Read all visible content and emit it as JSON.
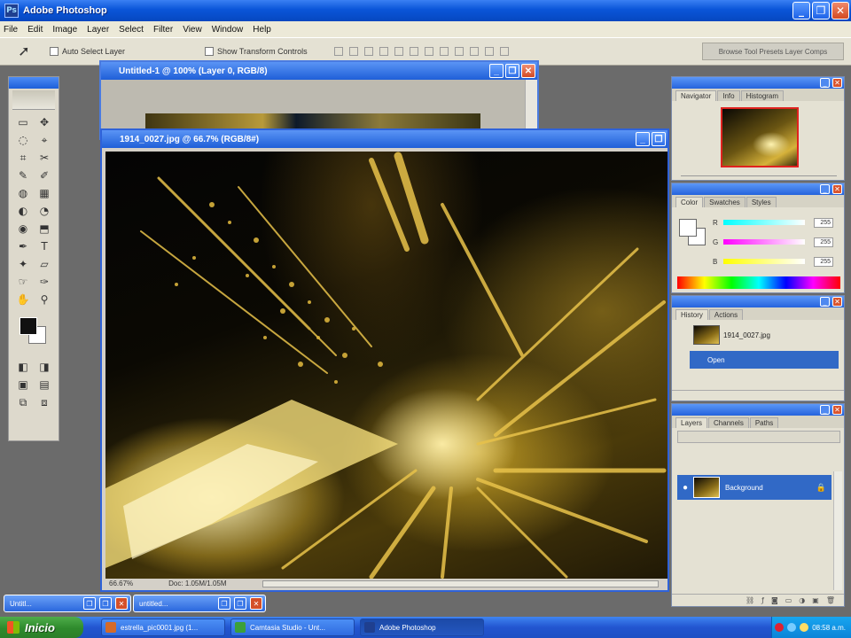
{
  "app": {
    "title": "Adobe Photoshop",
    "icon": "photoshop-icon",
    "window_buttons": {
      "minimize": "_",
      "restore": "❐",
      "close": "✕"
    }
  },
  "menu": [
    "File",
    "Edit",
    "Image",
    "Layer",
    "Select",
    "Filter",
    "View",
    "Window",
    "Help"
  ],
  "options": {
    "tool_icon": "move-tool-icon",
    "auto_select": "Auto Select Layer",
    "show_transform": "Show Transform Controls",
    "palette_well": "Browse  Tool Presets  Layer Comps"
  },
  "toolbox": {
    "tools": [
      "▭",
      "✥",
      "◌",
      "⌖",
      "⌗",
      "✂",
      "✎",
      "✐",
      "◍",
      "▦",
      "◐",
      "◔",
      "◉",
      "⬒",
      "✒",
      "T",
      "✦",
      "▱",
      "☞",
      "✑",
      "✋",
      "⚲"
    ],
    "bottom": [
      "◧",
      "◨",
      "▣",
      "▤",
      "⧉",
      "⧈"
    ]
  },
  "doc_back": {
    "title": "Untitled-1 @ 100% (Layer 0, RGB/8)"
  },
  "doc_front": {
    "title": "1914_0027.jpg @ 66.7% (RGB/8#)",
    "zoom": "66.67%",
    "doc_size": "Doc: 1.05M/1.05M"
  },
  "navigator": {
    "tabs": [
      "Navigator",
      "Info",
      "Histogram"
    ]
  },
  "color": {
    "tabs": [
      "Color",
      "Swatches",
      "Styles"
    ],
    "channels": [
      {
        "label": "R",
        "value": "255"
      },
      {
        "label": "G",
        "value": "255"
      },
      {
        "label": "B",
        "value": "255"
      }
    ]
  },
  "history": {
    "tabs": [
      "History",
      "Actions"
    ],
    "snapshot": "1914_0027.jpg",
    "step": "Open"
  },
  "layers": {
    "tabs": [
      "Layers",
      "Channels",
      "Paths"
    ],
    "layer_name": "Background",
    "lock_icon": "🔒"
  },
  "minimized": [
    {
      "label": "Untitl..."
    },
    {
      "label": "untitled..."
    }
  ],
  "taskbar": {
    "start": "Inicio",
    "items": [
      {
        "label": "estrella_pic0001.jpg (1...",
        "color": "#d46a2a"
      },
      {
        "label": "Camtasia Studio - Unt...",
        "color": "#3ca03a"
      },
      {
        "label": "Adobe Photoshop",
        "color": "#1f3f8f"
      }
    ],
    "clock": "08:58 a.m."
  },
  "colors": {
    "accent": "#3169c6",
    "title_blue": "#0a55d8",
    "gold": "#e0b83a"
  }
}
